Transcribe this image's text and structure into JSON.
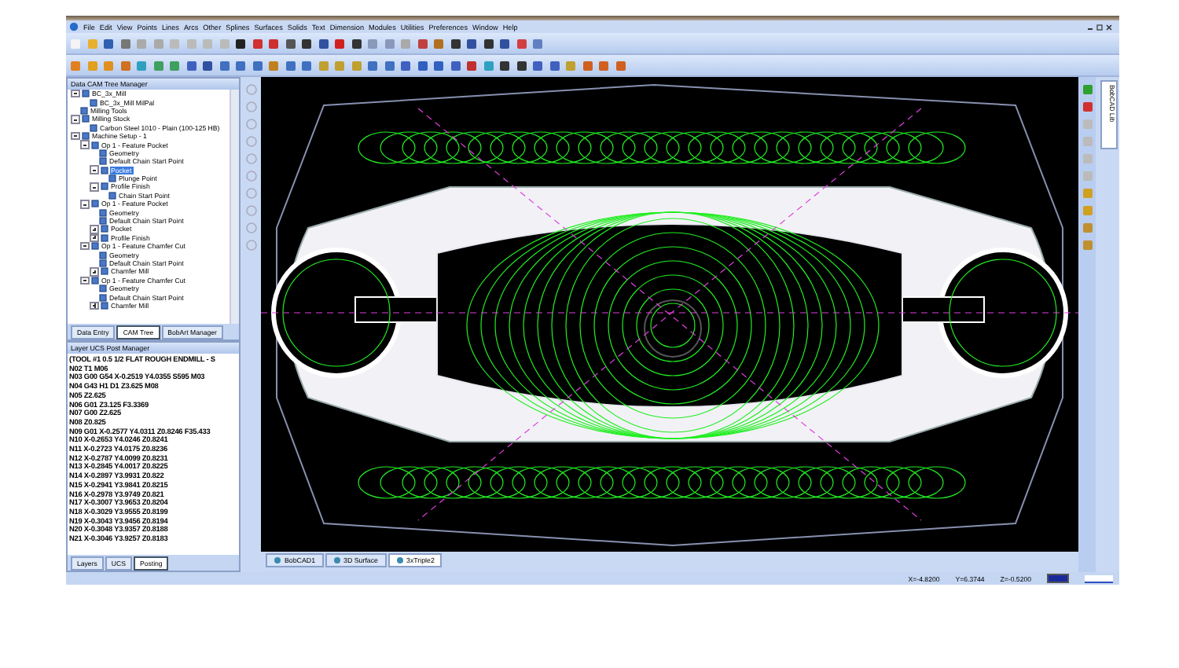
{
  "menu": [
    "File",
    "Edit",
    "View",
    "Points",
    "Lines",
    "Arcs",
    "Other",
    "Splines",
    "Surfaces",
    "Solids",
    "Text",
    "Dimension",
    "Modules",
    "Utilities",
    "Preferences",
    "Window",
    "Help"
  ],
  "tree_panel": {
    "title": "Data CAM Tree Manager",
    "items": [
      {
        "label": "BC_3x_Mill",
        "expanded": true,
        "selected": false,
        "children": [
          {
            "label": "BC_3x_Mill MilPal",
            "selected": false
          }
        ]
      },
      {
        "label": "Milling Tools",
        "selected": false
      },
      {
        "label": "Milling Stock",
        "expanded": true,
        "selected": false,
        "children": [
          {
            "label": "Carbon Steel 1010 - Plain (100-125 HB)",
            "selected": false
          }
        ]
      },
      {
        "label": "Machine Setup - 1",
        "expanded": true,
        "selected": false,
        "children": [
          {
            "label": "Op 1 - Feature Pocket",
            "expanded": true,
            "selected": false,
            "children": [
              {
                "label": "Geometry",
                "selected": false
              },
              {
                "label": "Default Chain Start Point",
                "selected": false
              },
              {
                "label": "Pocket",
                "expanded": true,
                "selected": true,
                "children": [
                  {
                    "label": "Plunge Point",
                    "selected": false
                  }
                ]
              },
              {
                "label": "Profile Finish",
                "expanded": true,
                "selected": false,
                "children": [
                  {
                    "label": "Chain Start Point",
                    "selected": false
                  }
                ]
              }
            ]
          },
          {
            "label": "Op 1 - Feature Pocket",
            "expanded": true,
            "selected": false,
            "children": [
              {
                "label": "Geometry",
                "selected": false
              },
              {
                "label": "Default Chain Start Point",
                "selected": false
              },
              {
                "label": "Pocket",
                "expanded": false,
                "selected": false
              },
              {
                "label": "Profile Finish",
                "expanded": false,
                "selected": false
              }
            ]
          },
          {
            "label": "Op 1 - Feature Chamfer Cut",
            "expanded": true,
            "selected": false,
            "children": [
              {
                "label": "Geometry",
                "selected": false
              },
              {
                "label": "Default Chain Start Point",
                "selected": false
              },
              {
                "label": "Chamfer Mill",
                "expanded": false,
                "selected": false
              }
            ]
          },
          {
            "label": "Op 1 - Feature Chamfer Cut",
            "expanded": true,
            "selected": false,
            "children": [
              {
                "label": "Geometry",
                "selected": false
              },
              {
                "label": "Default Chain Start Point",
                "selected": false
              },
              {
                "label": "Chamfer Mill",
                "expanded": false,
                "selected": false
              }
            ]
          }
        ]
      }
    ],
    "tabs": [
      {
        "label": "Data Entry",
        "selected": false
      },
      {
        "label": "CAM Tree",
        "selected": true
      },
      {
        "label": "BobArt Manager",
        "selected": false
      }
    ]
  },
  "posting_panel": {
    "title": "Layer UCS Post Manager",
    "lines": [
      "(TOOL #1 0.5 1/2 FLAT ROUGH ENDMILL - S",
      "N02 T1 M06",
      "N03 G00 G54 X-0.2519 Y4.0355 S595 M03",
      "N04 G43 H1 D1 Z3.625 M08",
      "N05 Z2.625",
      "N06 G01 Z3.125 F3.3369",
      "N07 G00 Z2.625",
      "N08 Z0.825",
      "N09 G01 X-0.2577 Y4.0311 Z0.8246 F35.433",
      "N10 X-0.2653 Y4.0246 Z0.8241",
      "N11 X-0.2723 Y4.0175 Z0.8236",
      "N12 X-0.2787 Y4.0099 Z0.8231",
      "N13 X-0.2845 Y4.0017 Z0.8225",
      "N14 X-0.2897 Y3.9931 Z0.822",
      "N15 X-0.2941 Y3.9841 Z0.8215",
      "N16 X-0.2978 Y3.9749 Z0.821",
      "N17 X-0.3007 Y3.9653 Z0.8204",
      "N18 X-0.3029 Y3.9555 Z0.8199",
      "N19 X-0.3043 Y3.9456 Z0.8194",
      "N20 X-0.3048 Y3.9357 Z0.8188",
      "N21 X-0.3046 Y3.9257 Z0.8183"
    ],
    "tabs": [
      {
        "label": "Layers",
        "selected": false
      },
      {
        "label": "UCS",
        "selected": false
      },
      {
        "label": "Posting",
        "selected": true
      }
    ]
  },
  "canvas_tabs": [
    {
      "label": "BobCAD1",
      "selected": false
    },
    {
      "label": "3D Surface",
      "selected": false
    },
    {
      "label": "3xTriple2",
      "selected": true
    }
  ],
  "side_tab": "BobCAD Lib",
  "status_bar": {
    "x": "X=-4.8200",
    "y": "Y=6.3744",
    "z": "Z=-0.5200"
  }
}
